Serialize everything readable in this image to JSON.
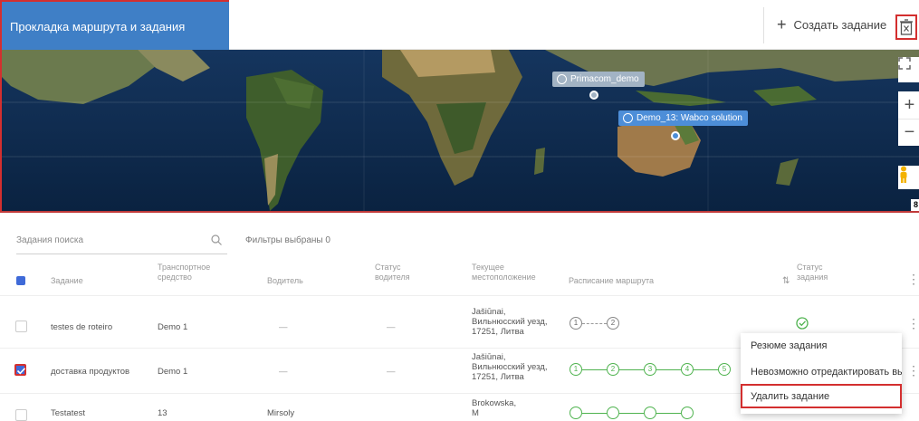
{
  "header": {
    "title": "Прокладка маршрута и задания",
    "create_label": "Создать задание"
  },
  "map": {
    "markers": [
      {
        "label": "Primacom_demo",
        "color": "#a2b3c4"
      },
      {
        "label": "Demo_13: Wabco solution",
        "color": "#4d8ed8"
      }
    ],
    "badge": "8"
  },
  "search": {
    "placeholder": "Задания поиска",
    "filters_label": "Фильтры выбраны 0"
  },
  "table": {
    "headers": {
      "task": "Задание",
      "vehicle_1": "Транспортное",
      "vehicle_2": "средство",
      "driver": "Водитель",
      "driver_status_1": "Статус",
      "driver_status_2": "водителя",
      "location_1": "Текущее",
      "location_2": "местоположение",
      "schedule": "Расписание маршрута",
      "task_status_1": "Статус",
      "task_status_2": "задания"
    },
    "rows": [
      {
        "task": "testes de roteiro",
        "vehicle": "Demo 1",
        "driver": "—",
        "driver_status": "—",
        "location_1": "Jašiūnai,",
        "location_2": "Вильнюсский уезд,",
        "location_3": "17251, Литва",
        "stops": [
          "1",
          "2"
        ]
      },
      {
        "task": "доставка продуктов",
        "vehicle": "Demo 1",
        "driver": "—",
        "driver_status": "—",
        "location_1": "Jašiūnai,",
        "location_2": "Вильнюсский уезд,",
        "location_3": "17251, Литва",
        "stops": [
          "1",
          "2",
          "3",
          "4",
          "5"
        ]
      },
      {
        "task": "Testatest",
        "vehicle": "13",
        "driver": "Mirsoly",
        "location_1": "Brokowska,",
        "location_2": "M"
      }
    ]
  },
  "context_menu": {
    "items": [
      "Резюме задания",
      "Невозможно отредактировать выполненное задание",
      "Удалить задание"
    ]
  },
  "colors": {
    "accent": "#3f7fc6",
    "highlight": "#d32f2f",
    "success": "#4fb34f"
  }
}
